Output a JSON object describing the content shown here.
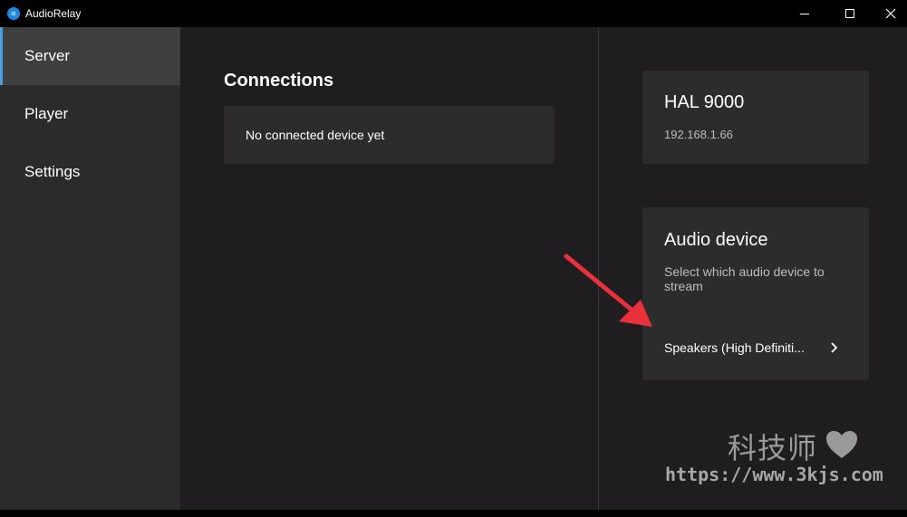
{
  "window": {
    "title": "AudioRelay"
  },
  "sidebar": {
    "items": [
      {
        "label": "Server",
        "active": true
      },
      {
        "label": "Player",
        "active": false
      },
      {
        "label": "Settings",
        "active": false
      }
    ]
  },
  "connections": {
    "title": "Connections",
    "empty_text": "No connected device yet"
  },
  "host": {
    "name": "HAL 9000",
    "ip": "192.168.1.66"
  },
  "audio_device": {
    "title": "Audio device",
    "description": "Select which audio device to stream",
    "selected": "Speakers (High Definiti..."
  },
  "watermark": {
    "text": "科技师",
    "url": "https://www.3kjs.com"
  },
  "colors": {
    "accent": "#4a9fe0",
    "annotation_arrow": "#e8313a"
  }
}
